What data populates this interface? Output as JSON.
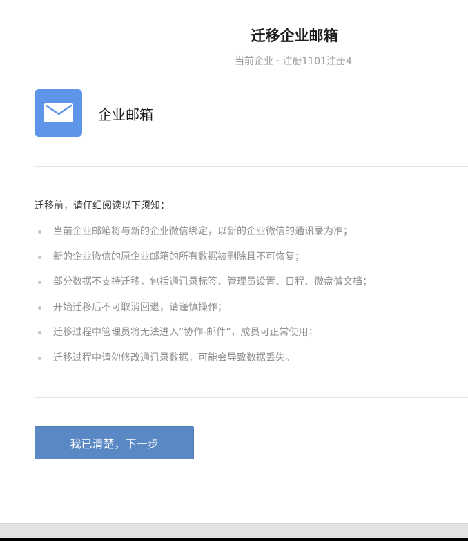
{
  "header": {
    "title": "迁移企业邮箱",
    "subtitle": "当前企业 · 注册1101注册4"
  },
  "product": {
    "icon": "mail-envelope-icon",
    "name": "企业邮箱",
    "icon_color": "#5e95e8"
  },
  "notice": {
    "heading": "迁移前，请仔细阅读以下须知：",
    "items": [
      "当前企业邮箱将与新的企业微信绑定，以新的企业微信的通讯录为准；",
      "新的企业微信的原企业邮箱的所有数据被删除且不可恢复；",
      "部分数据不支持迁移，包括通讯录标签、管理员设置、日程、微盘微文档；",
      "开始迁移后不可取消回退，请谨慎操作；",
      "迁移过程中管理员将无法进入“协作-邮件”，成员可正常使用；",
      "迁移过程中请勿修改通讯录数据，可能会导致数据丢失。"
    ]
  },
  "actions": {
    "next_label": "我已清楚，下一步",
    "button_color": "#5a88c4"
  }
}
